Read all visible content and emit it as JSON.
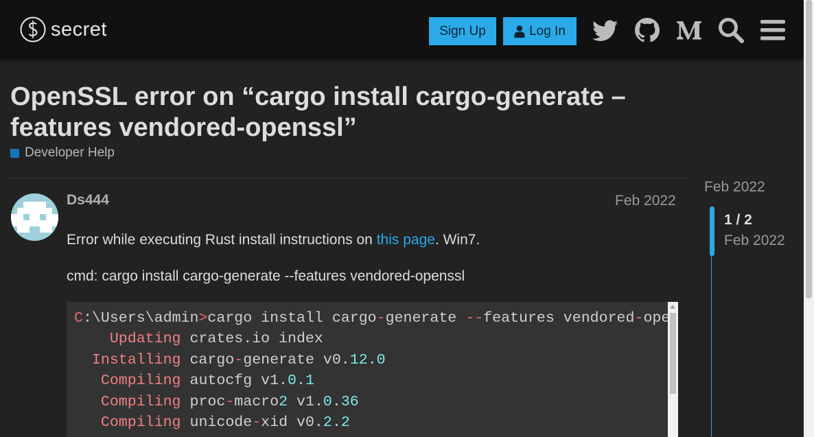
{
  "header": {
    "logo_text": "secret",
    "signup_label": "Sign Up",
    "login_label": "Log In",
    "icons": [
      "twitter-icon",
      "github-icon",
      "medium-icon",
      "search-icon",
      "hamburger-menu-icon"
    ]
  },
  "topic": {
    "title": "OpenSSL error on “cargo install cargo-generate –features vendored-openssl”",
    "category": "Developer Help",
    "category_color": "#0e76bd"
  },
  "post": {
    "username": "Ds444",
    "date": "Feb 2022",
    "p1_before": "Error while executing Rust install instructions on ",
    "p1_link": "this page",
    "p1_after": ". Win7.",
    "p2": "cmd: cargo install cargo-generate --features vendored-openssl",
    "code_lines": [
      "C:\\Users\\admin>cargo install cargo-generate --features vendored-openssl",
      "    Updating crates.io index",
      "  Installing cargo-generate v0.12.0",
      "   Compiling autocfg v1.0.1",
      "   Compiling proc-macro2 v1.0.36",
      "   Compiling unicode-xid v0.2.2"
    ]
  },
  "timeline": {
    "start_date": "Feb 2022",
    "position": "1 / 2",
    "current_date": "Feb 2022"
  },
  "colors": {
    "accent": "#2aaae8",
    "background": "#222222",
    "header_bg": "#111111"
  }
}
